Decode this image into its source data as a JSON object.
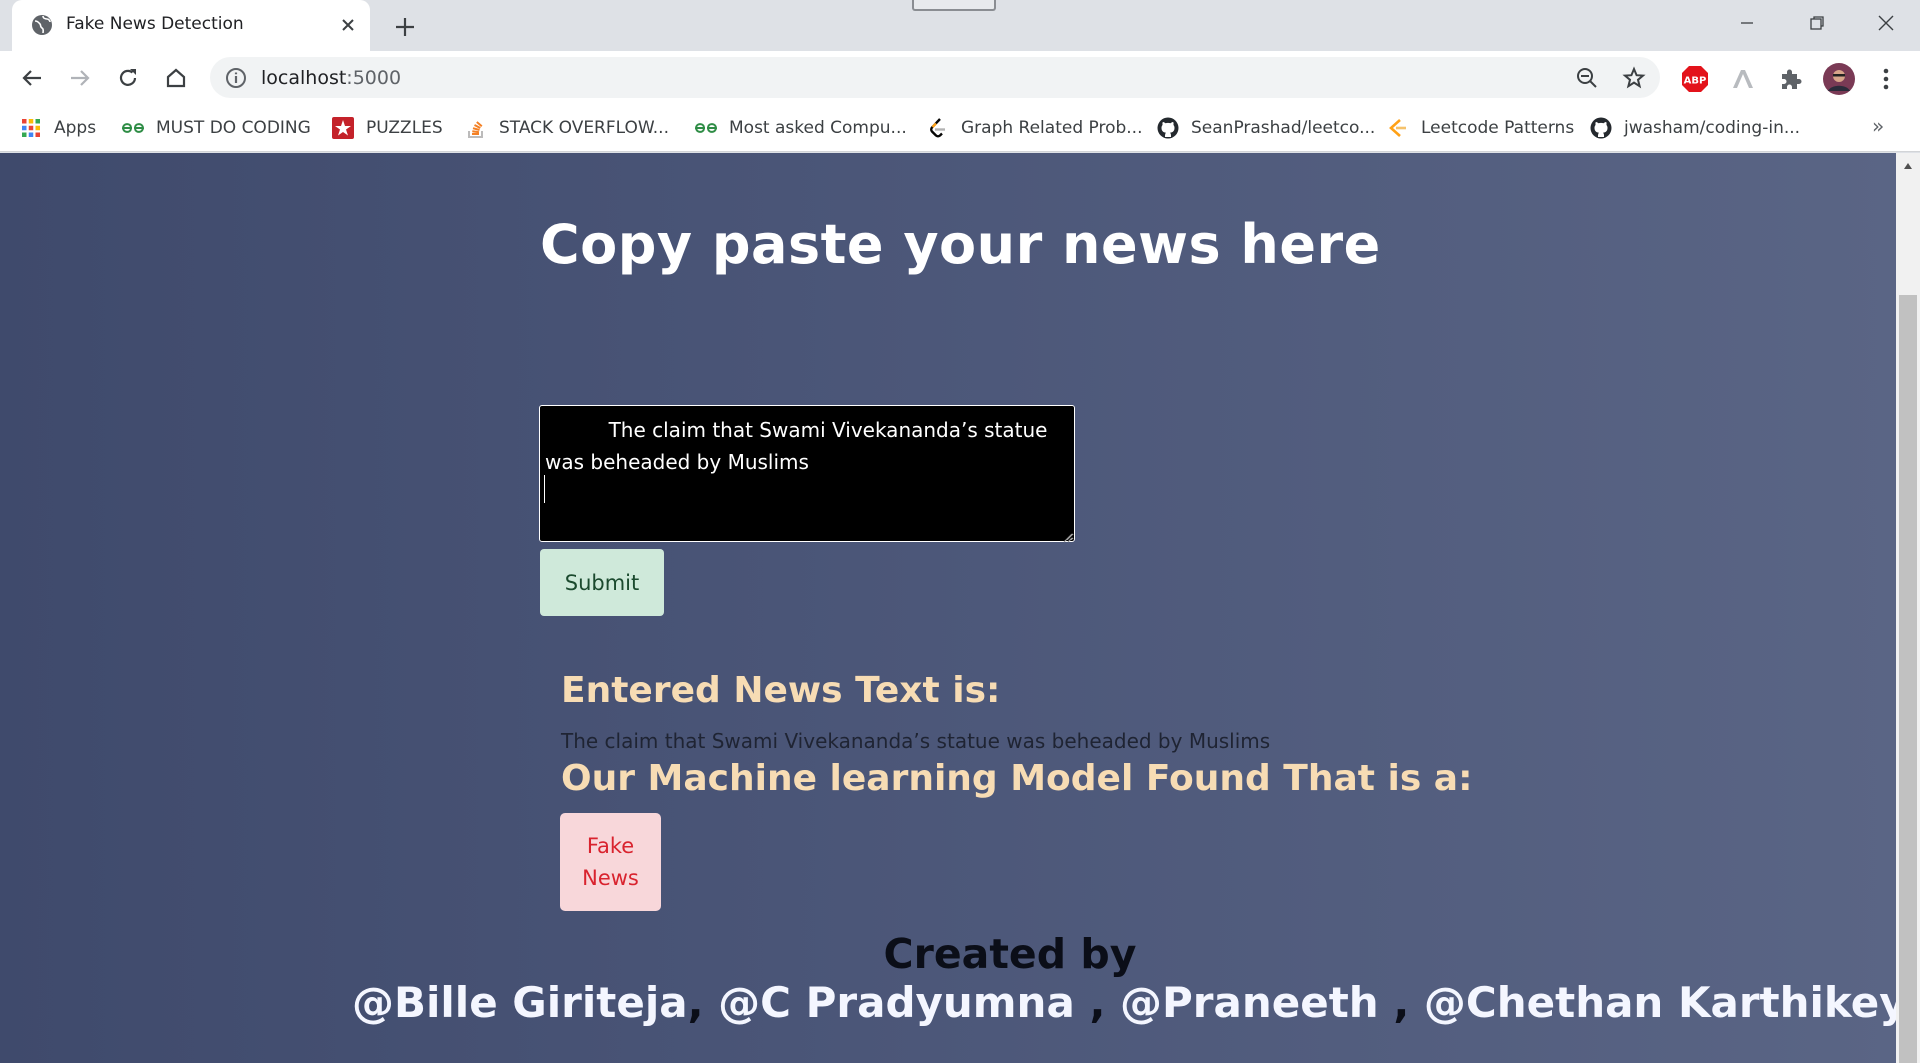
{
  "browser": {
    "tab_title": "Fake News Detection",
    "url_host": "localhost",
    "url_port": ":5000",
    "bookmarks": [
      {
        "label": "Apps",
        "icon": "apps-grid-icon"
      },
      {
        "label": "MUST DO CODING",
        "icon": "geeksforgeeks-icon"
      },
      {
        "label": "PUZZLES",
        "icon": "puzzle-star-icon"
      },
      {
        "label": "STACK OVERFLOW...",
        "icon": "stackoverflow-icon"
      },
      {
        "label": "Most asked Compu...",
        "icon": "geeksforgeeks-icon"
      },
      {
        "label": "Graph Related Prob...",
        "icon": "leetcode-icon"
      },
      {
        "label": "SeanPrashad/leetco...",
        "icon": "github-icon"
      },
      {
        "label": "Leetcode Patterns",
        "icon": "leetcode-patterns-icon"
      },
      {
        "label": "jwasham/coding-in...",
        "icon": "github-icon"
      }
    ],
    "bookmarks_more": "»",
    "extension_abp_label": "ABP"
  },
  "page": {
    "heading": "Copy paste your news here",
    "textarea_value": "          The claim that Swami Vivekananda’s statue was beheaded by Muslims\n",
    "submit_label": "Submit",
    "entered_heading": "Entered News Text is:",
    "entered_text": "The claim that Swami Vivekananda’s statue was beheaded by Muslims",
    "model_heading": "Our Machine learning Model Found That is a:",
    "result_label": "Fake News",
    "created_by": "Created by",
    "authors": [
      "@Bille Giriteja",
      "@C Pradyumna ",
      "@Praneeth ",
      "@Chethan Karthikeya"
    ],
    "author_separators": [
      ", ",
      ", ",
      ", ",
      "."
    ]
  },
  "colors": {
    "heading_accent": "#f7dcb4",
    "result_bg": "#f8d7da",
    "result_text": "#d9232e",
    "submit_bg": "#cfe9da"
  }
}
